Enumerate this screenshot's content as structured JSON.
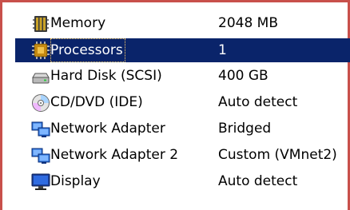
{
  "colors": {
    "selection_bg": "#0a246a",
    "selection_text": "#ffffff",
    "frame_border": "#c8504b"
  },
  "devices": [
    {
      "icon": "memory-icon",
      "name": "Memory",
      "summary": "2048 MB",
      "selected": false
    },
    {
      "icon": "processor-icon",
      "name": "Processors",
      "summary": "1",
      "selected": true
    },
    {
      "icon": "hard-disk-icon",
      "name": "Hard Disk (SCSI)",
      "summary": "400 GB",
      "selected": false
    },
    {
      "icon": "cd-dvd-icon",
      "name": "CD/DVD (IDE)",
      "summary": "Auto detect",
      "selected": false
    },
    {
      "icon": "network-adapter-icon",
      "name": "Network Adapter",
      "summary": "Bridged",
      "selected": false
    },
    {
      "icon": "network-adapter-icon",
      "name": "Network Adapter 2",
      "summary": "Custom (VMnet2)",
      "selected": false
    },
    {
      "icon": "display-icon",
      "name": "Display",
      "summary": "Auto detect",
      "selected": false
    }
  ]
}
